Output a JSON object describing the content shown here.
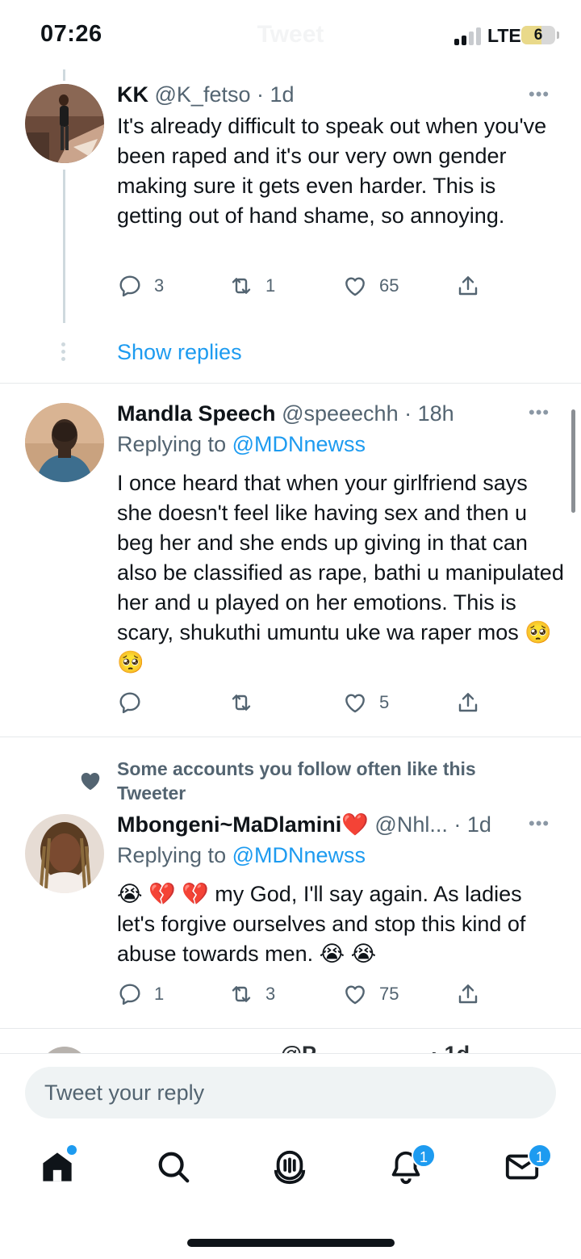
{
  "status_bar": {
    "time": "07:26",
    "network": "LTE",
    "battery": "6",
    "header_title_faded": "Tweet"
  },
  "tweets": [
    {
      "name": "KK",
      "handle": "@K_fetso",
      "time": "1d",
      "text": "It's already difficult to speak out when you've been raped and it's our very own gender making sure it gets even harder. This is getting out of hand shame, so annoying.",
      "replies": "3",
      "retweets": "1",
      "likes": "65",
      "show_replies": "Show replies"
    },
    {
      "name": "Mandla Speech",
      "handle": "@speeechh",
      "time": "18h",
      "replying_label": "Replying to",
      "replying_to": "@MDNnewss",
      "text": "I once heard that when your girlfriend says she doesn't feel like having sex and then u beg her and she ends up giving in that can also be classified as  rape, bathi u manipulated her and u played on her emotions. This is scary, shukuthi umuntu uke wa raper mos 🥺 🥺",
      "replies": "",
      "retweets": "",
      "likes": "5"
    },
    {
      "social_context": "Some accounts you follow often like this Tweeter",
      "name": "Mbongeni~MaDlamini❤️",
      "handle": "@Nhl...",
      "time": "1d",
      "replying_label": "Replying to",
      "replying_to": "@MDNnewss",
      "text": "😭 💔 💔  my God, I'll say again. As ladies let's forgive ourselves and stop this kind of abuse towards men. 😭 😭",
      "replies": "1",
      "retweets": "3",
      "likes": "75"
    }
  ],
  "peek_text": "_ _ _ _ _ _ _ _ _ @P _ _ _ _ _ _ · 1d",
  "reply_bar": {
    "placeholder": "Tweet your reply"
  },
  "bottom_nav": {
    "items": [
      "home-icon",
      "search-icon",
      "spaces-icon",
      "notifications-icon",
      "messages-icon"
    ],
    "notifications_badge": "1",
    "messages_badge": "1"
  },
  "colors": {
    "accent": "#1d9bf0",
    "text": "#0f1419",
    "muted": "#536471"
  }
}
